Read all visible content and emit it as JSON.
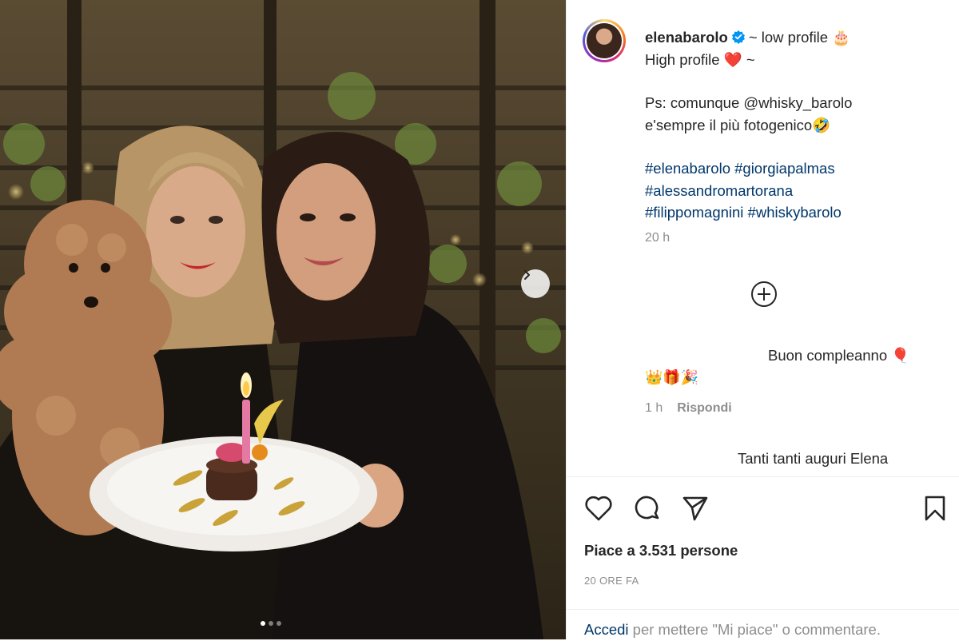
{
  "post": {
    "username": "elenabarolo",
    "caption_line1_rest": "~ low profile 🎂",
    "caption_line2": "High profile ❤️ ~",
    "caption_line3": "Ps: comunque @whisky_barolo",
    "caption_line4": "e'sempre il più fotogenico🤣",
    "hashtags_line1": "#elenabarolo #giorgiapalmas",
    "hashtags_line2": "#alessandromartorana",
    "hashtags_line3": "#filippomagnini #whiskybarolo",
    "time": "20 h"
  },
  "comments": [
    {
      "text": "Buon compleanno 🎈",
      "emoji": "👑🎁🎉",
      "time": "1 h",
      "reply_label": "Rispondi"
    },
    {
      "text": "Tanti tanti auguri Elena"
    }
  ],
  "likes": "Piace a 3.531 persone",
  "posted_ago": "20 ORE FA",
  "login": {
    "link": "Accedi",
    "rest": " per mettere \"Mi piace\" o commentare."
  },
  "carousel": {
    "count": 3,
    "active": 1
  },
  "icons": [
    "verified-badge-icon",
    "add-comment-icon",
    "heart-icon",
    "comment-icon",
    "share-icon",
    "bookmark-icon",
    "chevron-right-icon"
  ],
  "colors": {
    "link": "#00376b",
    "muted": "#8e8e8e",
    "verified": "#0095f6",
    "text": "#262626"
  }
}
